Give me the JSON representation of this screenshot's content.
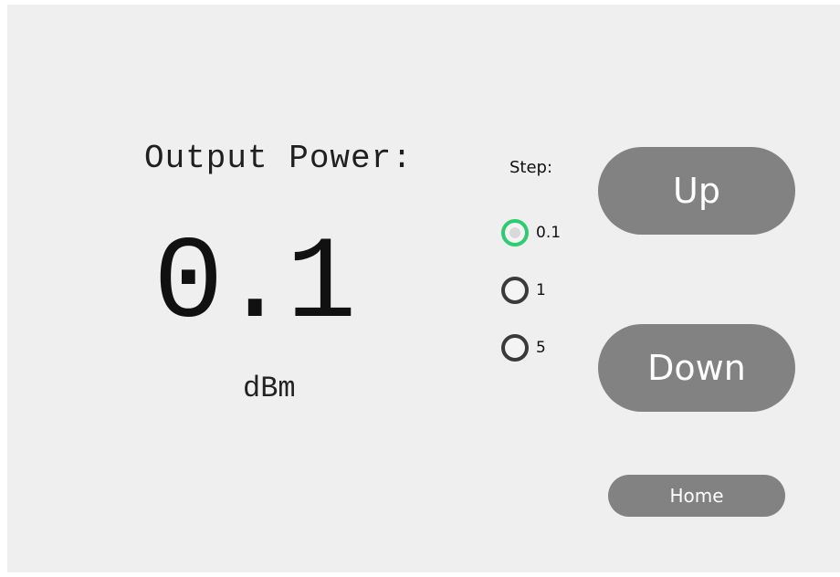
{
  "display": {
    "label": "Output Power:",
    "value": "0.1",
    "unit": "dBm"
  },
  "step": {
    "label": "Step:",
    "options": [
      {
        "label": "0.1",
        "selected": true
      },
      {
        "label": "1",
        "selected": false
      },
      {
        "label": "5",
        "selected": false
      }
    ],
    "selected_color": "#2ecc71"
  },
  "buttons": {
    "up": "Up",
    "down": "Down",
    "home": "Home",
    "color": "#828282"
  }
}
